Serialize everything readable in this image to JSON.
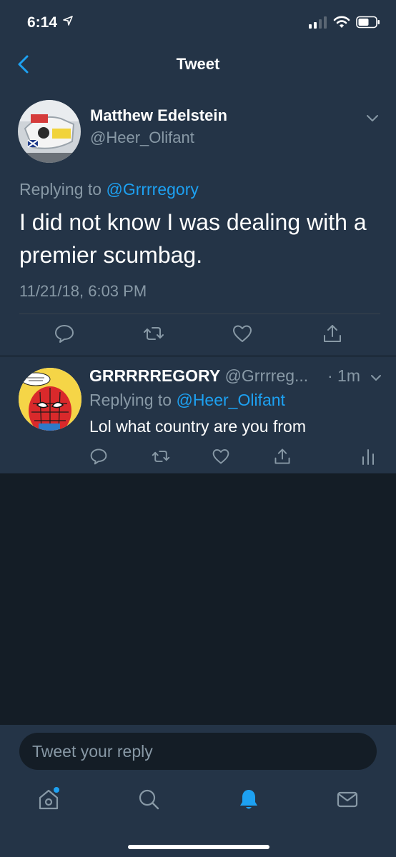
{
  "status_bar": {
    "time": "6:14"
  },
  "nav": {
    "title": "Tweet"
  },
  "main_tweet": {
    "name": "Matthew Edelstein",
    "handle": "@Heer_Olifant",
    "replying_prefix": "Replying to ",
    "replying_to": "@Grrrregory",
    "text": "I did not know I was dealing with a premier scumbag.",
    "timestamp": "11/21/18, 6:03 PM"
  },
  "reply_tweet": {
    "name": "GRRRRREGORY",
    "handle": "@Grrrreg...",
    "time": "· 1m",
    "replying_prefix": "Replying to ",
    "replying_to": "@Heer_Olifant",
    "text": "Lol what country are you from"
  },
  "composer": {
    "placeholder": "Tweet your reply"
  },
  "colors": {
    "accent": "#1da1f2",
    "background": "#141d26",
    "surface": "#243447",
    "muted": "#8899a6"
  },
  "icons": [
    "back-arrow-icon",
    "comment-icon",
    "retweet-icon",
    "like-icon",
    "share-icon",
    "analytics-icon",
    "home-icon",
    "search-icon",
    "notifications-icon",
    "messages-icon"
  ]
}
